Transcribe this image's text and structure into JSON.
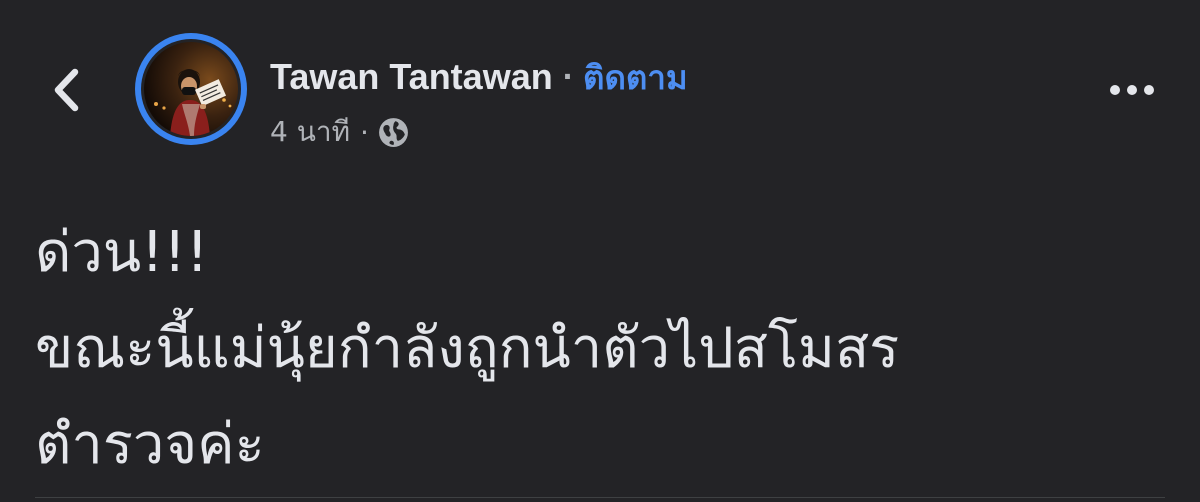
{
  "navigation": {
    "back_icon": "chevron-left-icon"
  },
  "post": {
    "author": {
      "name": "Tawan Tantawan",
      "name_separator": "·",
      "follow_label": "ติดตาม",
      "avatar": "profile-photo"
    },
    "meta": {
      "time": "4 นาที",
      "separator": "·",
      "privacy_icon": "globe-icon"
    },
    "more_icon": "more-horizontal-icon",
    "body_lines": [
      "ด่วน!!!",
      "ขณะนี้แม่นุ้ยกำลังถูกนำตัวไปสโมสร",
      "ตำรวจค่ะ"
    ]
  },
  "colors": {
    "background": "#232326",
    "text_primary": "#e4e6eb",
    "text_secondary": "#b0b3b8",
    "accent": "#4d8ef2",
    "avatar_ring": "#3a84f0"
  }
}
